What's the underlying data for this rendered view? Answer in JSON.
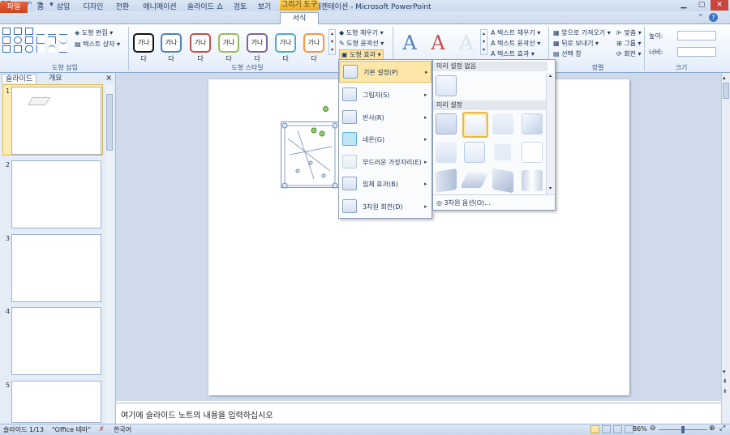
{
  "window": {
    "title": "새 프레젠테이션 - Microsoft PowerPoint"
  },
  "tabs": [
    "파일",
    "홈",
    "삽입",
    "디자인",
    "전환",
    "애니메이션",
    "슬라이드 쇼",
    "검토",
    "보기"
  ],
  "context_tab": {
    "group": "그리기 도구",
    "tab": "서식"
  },
  "ribbon": {
    "insert_shapes": {
      "edit_shape": "도형 편집",
      "text_box": "텍스트 상자",
      "label": "도형 삽입"
    },
    "shape_styles": {
      "preset_text": "가나다",
      "fill": "도형 채우기",
      "outline": "도형 윤곽선",
      "effects": "도형 효과",
      "label": "도형 스타일"
    },
    "wordart": {
      "glyph": "A",
      "text_fill": "텍스트 채우기",
      "text_outline": "텍스트 윤곽선",
      "text_effects": "텍스트 효과"
    },
    "arrange": {
      "bring_forward": "앞으로 가져오기",
      "send_backward": "뒤로 보내기",
      "selection_pane": "선택 창",
      "align": "맞춤",
      "group": "그룹",
      "rotate": "회전",
      "label": "정렬"
    },
    "size": {
      "height_label": "높이:",
      "width_label": "너비:",
      "label": "크기"
    }
  },
  "left_panel": {
    "tabs": [
      "슬라이드",
      "개요"
    ],
    "close": "×",
    "slide_numbers": [
      "1",
      "2",
      "3",
      "4",
      "5"
    ]
  },
  "effects_menu": {
    "items": [
      "기본 설정(P)",
      "그림자(S)",
      "반사(R)",
      "네온(G)",
      "부드러운 가장자리(E)",
      "입체 효과(B)",
      "3차원 회전(D)"
    ]
  },
  "preset_submenu": {
    "no_preset": "미리 설정 없음",
    "presets": "미리 설정",
    "options": "3차원 옵션(O)..."
  },
  "notes": {
    "placeholder": "여기에 슬라이드 노트의 내용을 입력하십시오"
  },
  "status": {
    "slide": "슬라이드 1/13",
    "theme": "\"Office 테마\"",
    "language": "한국어",
    "zoom": "86%"
  },
  "colors": {
    "file_tab": "#d5532c",
    "context": "#eba81e",
    "ribbon": "#e3edf9"
  },
  "icons": [
    "save-icon",
    "undo-icon",
    "redo-icon",
    "minimize-icon",
    "maximize-icon",
    "close-icon",
    "help-icon"
  ]
}
